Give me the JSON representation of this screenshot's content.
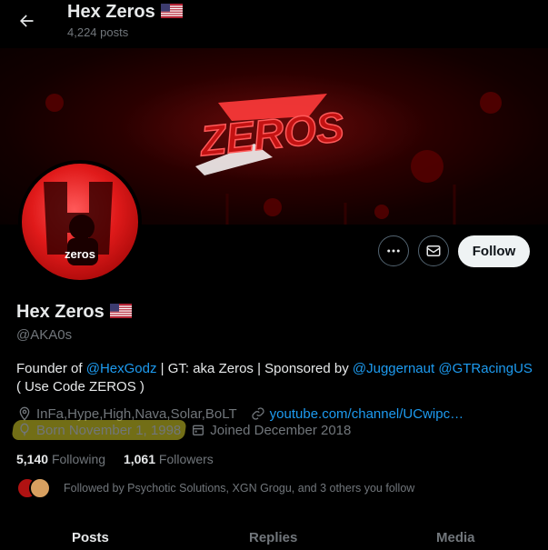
{
  "header": {
    "name": "Hex Zeros",
    "posts_count": "4,224 posts"
  },
  "banner": {
    "logo_text": "ZEROS"
  },
  "avatar": {
    "label": "zeros"
  },
  "actions": {
    "follow_label": "Follow"
  },
  "profile": {
    "name": "Hex Zeros",
    "handle": "@AKA0s",
    "bio": {
      "p1": "Founder of ",
      "link1": "@HexGodz",
      "p2": " | GT: aka Zeros | Sponsored by ",
      "link2": "@Juggernaut",
      "p3": " ",
      "link3": "@GTRacingUS",
      "line2": "( Use Code ZEROS )"
    },
    "location": "InFa,Hype,High,Nava,Solar,BoLT",
    "website": "youtube.com/channel/UCwipc…",
    "birthday": "Born November 1, 1998",
    "joined": "Joined December 2018",
    "following_count": "5,140",
    "following_label": "Following",
    "followers_count": "1,061",
    "followers_label": "Followers",
    "followed_by": "Followed by Psychotic Solutions, XGN Grogu, and 3 others you follow"
  },
  "tabs": [
    "Posts",
    "Replies",
    "Media"
  ],
  "colors": {
    "accent": "#1d9bf0",
    "highlight": "#d0c828",
    "avatar_red": "#e01a1a"
  }
}
